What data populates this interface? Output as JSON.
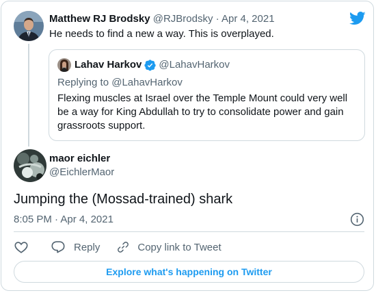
{
  "colors": {
    "twitter_blue": "#1d9bf0",
    "text": "#0f1419",
    "muted": "#536471",
    "border": "#cfd9de"
  },
  "parent_tweet": {
    "author_name": "Matthew RJ Brodsky",
    "author_handle": "@RJBrodsky",
    "separator": "·",
    "date": "Apr 4, 2021",
    "text": "He needs to find a new a way. This is overplayed.",
    "avatar_icon": "profile-photo",
    "brand_icon": "twitter-bird-icon"
  },
  "quoted_tweet": {
    "author_name": "Lahav Harkov",
    "author_handle": "@LahavHarkov",
    "verified_icon": "verified-badge-icon",
    "replying_to": "Replying to @LahavHarkov",
    "text": "Flexing muscles at Israel over the Temple Mount could very well be a way for King Abdullah to try to consolidate power and gain grassroots support."
  },
  "main_tweet": {
    "author_name": "maor eichler",
    "author_handle": "@EichlerMaor",
    "text": "Jumping the (Mossad-trained) shark",
    "time": "8:05 PM",
    "separator": "·",
    "date": "Apr 4, 2021",
    "info_icon": "info-icon"
  },
  "actions": {
    "like_icon": "heart-icon",
    "reply_label": "Reply",
    "reply_icon": "reply-icon",
    "copy_label": "Copy link to Tweet",
    "copy_icon": "link-icon"
  },
  "explore_button": {
    "label": "Explore what's happening on Twitter"
  }
}
